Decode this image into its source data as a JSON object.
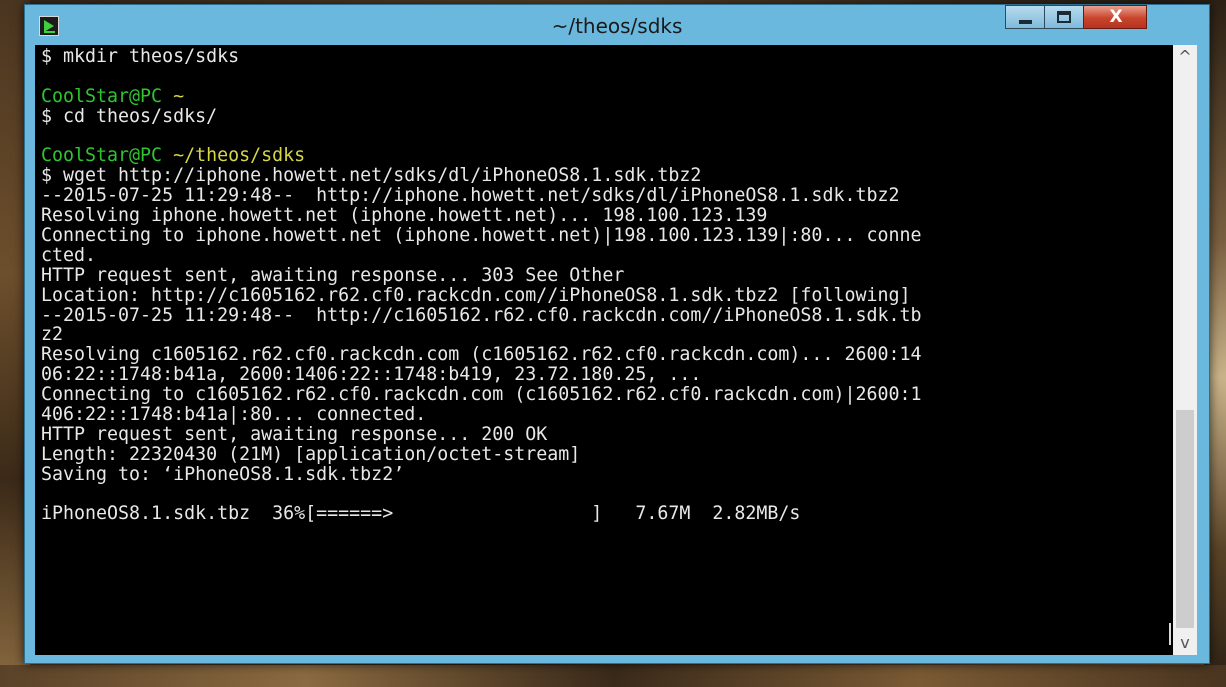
{
  "window": {
    "title": "~/theos/sdks",
    "close_glyph": "X"
  },
  "terminal": {
    "lines": [
      {
        "text": "$ mkdir theos/sdks",
        "color": "white"
      },
      {
        "text": "",
        "color": "white"
      },
      {
        "prompt_user": "CoolStar@PC",
        "prompt_path": "~"
      },
      {
        "text": "$ cd theos/sdks/",
        "color": "white"
      },
      {
        "text": "",
        "color": "white"
      },
      {
        "prompt_user": "CoolStar@PC",
        "prompt_path": "~/theos/sdks"
      },
      {
        "text": "$ wget http://iphone.howett.net/sdks/dl/iPhoneOS8.1.sdk.tbz2",
        "color": "white"
      },
      {
        "text": "--2015-07-25 11:29:48--  http://iphone.howett.net/sdks/dl/iPhoneOS8.1.sdk.tbz2",
        "color": "white"
      },
      {
        "text": "Resolving iphone.howett.net (iphone.howett.net)... 198.100.123.139",
        "color": "white"
      },
      {
        "text": "Connecting to iphone.howett.net (iphone.howett.net)|198.100.123.139|:80... conne",
        "color": "white"
      },
      {
        "text": "cted.",
        "color": "white"
      },
      {
        "text": "HTTP request sent, awaiting response... 303 See Other",
        "color": "white"
      },
      {
        "text": "Location: http://c1605162.r62.cf0.rackcdn.com//iPhoneOS8.1.sdk.tbz2 [following]",
        "color": "white"
      },
      {
        "text": "--2015-07-25 11:29:48--  http://c1605162.r62.cf0.rackcdn.com//iPhoneOS8.1.sdk.tb",
        "color": "white"
      },
      {
        "text": "z2",
        "color": "white"
      },
      {
        "text": "Resolving c1605162.r62.cf0.rackcdn.com (c1605162.r62.cf0.rackcdn.com)... 2600:14",
        "color": "white"
      },
      {
        "text": "06:22::1748:b41a, 2600:1406:22::1748:b419, 23.72.180.25, ...",
        "color": "white"
      },
      {
        "text": "Connecting to c1605162.r62.cf0.rackcdn.com (c1605162.r62.cf0.rackcdn.com)|2600:1",
        "color": "white"
      },
      {
        "text": "406:22::1748:b41a|:80... connected.",
        "color": "white"
      },
      {
        "text": "HTTP request sent, awaiting response... 200 OK",
        "color": "white"
      },
      {
        "text": "Length: 22320430 (21M) [application/octet-stream]",
        "color": "white"
      },
      {
        "text": "Saving to: ‘iPhoneOS8.1.sdk.tbz2’",
        "color": "white"
      },
      {
        "text": "",
        "color": "white"
      },
      {
        "text": "iPhoneOS8.1.sdk.tbz  36%[======>                  ]   7.67M  2.82MB/s",
        "color": "white"
      }
    ],
    "progress_percent": 36
  },
  "scrollbar": {
    "up_glyph": "^",
    "down_glyph": "v"
  }
}
